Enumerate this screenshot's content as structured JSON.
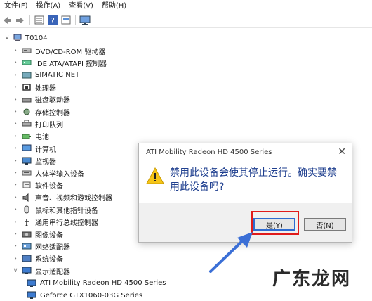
{
  "menu": [
    "文件(F)",
    "操作(A)",
    "查看(V)",
    "帮助(H)"
  ],
  "toolbar": {
    "icons": [
      "back-icon",
      "forward-icon",
      "view-icon",
      "help-icon",
      "properties-icon",
      "monitor-icon"
    ]
  },
  "tree": {
    "root": "T0104",
    "categories": [
      {
        "label": "DVD/CD-ROM 驱动器",
        "icon": "disc-drive-icon"
      },
      {
        "label": "IDE ATA/ATAPI 控制器",
        "icon": "ide-controller-icon"
      },
      {
        "label": "SIMATIC NET",
        "icon": "network-card-icon"
      },
      {
        "label": "处理器",
        "icon": "processor-icon"
      },
      {
        "label": "磁盘驱动器",
        "icon": "disk-drive-icon"
      },
      {
        "label": "存储控制器",
        "icon": "storage-controller-icon"
      },
      {
        "label": "打印队列",
        "icon": "printer-icon"
      },
      {
        "label": "电池",
        "icon": "battery-icon"
      },
      {
        "label": "计算机",
        "icon": "computer-icon"
      },
      {
        "label": "监视器",
        "icon": "monitor-icon"
      },
      {
        "label": "人体学输入设备",
        "icon": "hid-icon"
      },
      {
        "label": "软件设备",
        "icon": "software-device-icon"
      },
      {
        "label": "声音、视频和游戏控制器",
        "icon": "sound-icon"
      },
      {
        "label": "鼠标和其他指针设备",
        "icon": "mouse-icon"
      },
      {
        "label": "通用串行总线控制器",
        "icon": "usb-icon"
      },
      {
        "label": "图像设备",
        "icon": "camera-icon"
      },
      {
        "label": "网络适配器",
        "icon": "network-adapter-icon"
      },
      {
        "label": "系统设备",
        "icon": "system-device-icon"
      },
      {
        "label": "显示适配器",
        "icon": "display-adapter-icon"
      }
    ],
    "display_children": [
      {
        "label": "ATI Mobility Radeon HD 4500 Series",
        "icon": "display-card-icon"
      },
      {
        "label": "Geforce GTX1060-03G Series",
        "icon": "display-card-icon"
      }
    ]
  },
  "dialog": {
    "title": "ATI Mobility Radeon HD 4500 Series",
    "message": "禁用此设备会使其停止运行。确实要禁用此设备吗?",
    "yes_label": "是(Y)",
    "no_label": "否(N)"
  },
  "watermark": "广东龙网",
  "colors": {
    "highlight": "#e01b1b",
    "arrow": "#3b6fd6",
    "message": "#1f3f8f"
  }
}
